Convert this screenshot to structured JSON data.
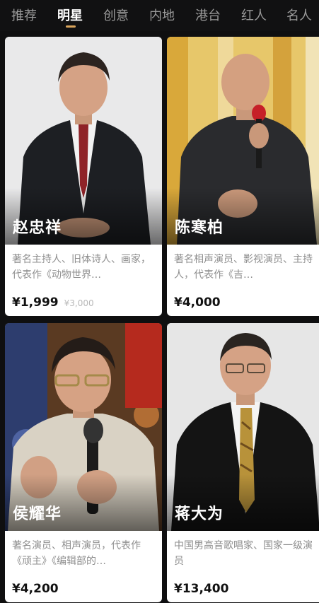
{
  "tabs": [
    "推荐",
    "明星",
    "创意",
    "内地",
    "港台",
    "红人",
    "名人"
  ],
  "active_tab": "明星",
  "accent_color": "#d9a45b",
  "cards": [
    {
      "name": "赵忠祥",
      "description": "著名主持人、旧体诗人、画家，代表作《动物世界…",
      "price": "¥1,999",
      "original_price": "¥3,000"
    },
    {
      "name": "陈寒柏",
      "description": "著名相声演员、影视演员、主持人，代表作《吉…",
      "price": "¥4,000"
    },
    {
      "name": "侯耀华",
      "description": "著名演员、相声演员，代表作《顽主》《编辑部的…",
      "price": "¥4,200"
    },
    {
      "name": "蒋大为",
      "description": "中国男高音歌唱家、国家一级演员",
      "price": "¥13,400"
    }
  ]
}
